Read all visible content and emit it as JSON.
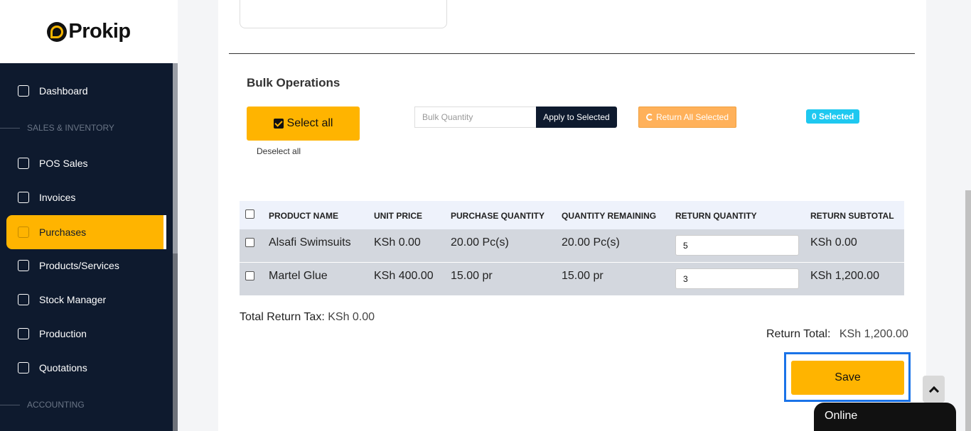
{
  "brand": {
    "name": "Prokip"
  },
  "sidebar": {
    "items": [
      {
        "label": "Dashboard",
        "icon": "home-icon"
      },
      {
        "label": "POS Sales",
        "icon": "basket-icon"
      },
      {
        "label": "Invoices",
        "icon": "invoice-icon"
      },
      {
        "label": "Purchases",
        "icon": "box-icon",
        "active": true
      },
      {
        "label": "Products/Services",
        "icon": "cube-icon"
      },
      {
        "label": "Stock Manager",
        "icon": "stock-icon"
      },
      {
        "label": "Production",
        "icon": "factory-icon"
      },
      {
        "label": "Quotations",
        "icon": "calculator-icon"
      }
    ],
    "sections": [
      "SALES & INVENTORY",
      "ACCOUNTING"
    ]
  },
  "bulk": {
    "title": "Bulk Operations",
    "select_all": "Select all",
    "deselect_all": "Deselect all",
    "quantity_placeholder": "Bulk Quantity",
    "apply_label": "Apply to Selected",
    "return_all_label": "Return All Selected",
    "selected_badge": "0 Selected"
  },
  "table": {
    "headers": [
      "PRODUCT NAME",
      "UNIT PRICE",
      "PURCHASE QUANTITY",
      "QUANTITY REMAINING",
      "RETURN QUANTITY",
      "RETURN SUBTOTAL"
    ],
    "rows": [
      {
        "product": "Alsafi Swimsuits",
        "unit_price": "KSh 0.00",
        "purchase_qty": "20.00 Pc(s)",
        "remaining": "20.00 Pc(s)",
        "return_qty": "5",
        "subtotal": "KSh 0.00"
      },
      {
        "product": "Martel Glue",
        "unit_price": "KSh 400.00",
        "purchase_qty": "15.00 pr",
        "remaining": "15.00 pr",
        "return_qty": "3",
        "subtotal": "KSh 1,200.00"
      }
    ]
  },
  "totals": {
    "tax_label": "Total Return Tax:",
    "tax_value": "KSh 0.00",
    "return_total_label": "Return Total:",
    "return_total_value": "KSh 1,200.00"
  },
  "actions": {
    "save": "Save"
  },
  "chat": {
    "status": "Online"
  },
  "colors": {
    "accent": "#ffb400",
    "sidebar": "#0e1a2e",
    "badge": "#1ec8f0",
    "focus": "#1a73e8"
  }
}
